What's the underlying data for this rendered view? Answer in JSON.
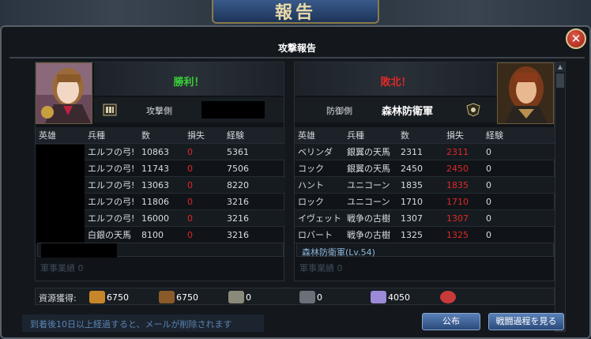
{
  "banner": {
    "title": "報告"
  },
  "window": {
    "title": "攻撃報告",
    "close_label": "✕"
  },
  "attacker": {
    "result": "勝利！",
    "side_label": "攻撃側",
    "headers": [
      "英雄",
      "兵種",
      "数",
      "損失",
      "経験"
    ],
    "rows": [
      {
        "hero": "",
        "type": "エルフの弓!",
        "num": "10863",
        "loss": "0",
        "exp": "5361"
      },
      {
        "hero": "",
        "type": "エルフの弓!",
        "num": "11743",
        "loss": "0",
        "exp": "7506"
      },
      {
        "hero": "",
        "type": "エルフの弓!",
        "num": "13063",
        "loss": "0",
        "exp": "8220"
      },
      {
        "hero": "",
        "type": "エルフの弓!",
        "num": "11806",
        "loss": "0",
        "exp": "3216"
      },
      {
        "hero": "",
        "type": "エルフの弓!",
        "num": "16000",
        "loss": "0",
        "exp": "3216"
      },
      {
        "hero": "",
        "type": "白銀の天馬",
        "num": "8100",
        "loss": "0",
        "exp": "3216"
      }
    ],
    "merit": "軍事業績 0"
  },
  "defender": {
    "result": "敗北！",
    "side_label": "防御側",
    "name": "森林防衛軍",
    "headers": [
      "英雄",
      "兵種",
      "数",
      "損失",
      "経験"
    ],
    "rows": [
      {
        "hero": "ベリンダ",
        "type": "銀翼の天馬",
        "num": "2311",
        "loss": "2311",
        "exp": "0"
      },
      {
        "hero": "コック",
        "type": "銀翼の天馬",
        "num": "2450",
        "loss": "2450",
        "exp": "0"
      },
      {
        "hero": "ハント",
        "type": "ユニコーン",
        "num": "1835",
        "loss": "1835",
        "exp": "0"
      },
      {
        "hero": "ロック",
        "type": "ユニコーン",
        "num": "1710",
        "loss": "1710",
        "exp": "0"
      },
      {
        "hero": "イヴェット",
        "type": "戦争の古樹",
        "num": "1307",
        "loss": "1307",
        "exp": "0"
      },
      {
        "hero": "ロバート",
        "type": "戦争の古樹",
        "num": "1325",
        "loss": "1325",
        "exp": "0"
      }
    ],
    "army_info": "森林防衛軍(Lv.54)",
    "merit": "軍事業績 0"
  },
  "resources": {
    "label": "資源獲得:",
    "items": [
      {
        "icon": "food-icon",
        "value": "6750",
        "color": "#c8862a"
      },
      {
        "icon": "wood-icon",
        "value": "6750",
        "color": "#8a5a2a"
      },
      {
        "icon": "stone-icon",
        "value": "0",
        "color": "#8a8a7a"
      },
      {
        "icon": "iron-icon",
        "value": "0",
        "color": "#6a7078"
      },
      {
        "icon": "crystal-icon",
        "value": "4050",
        "color": "#9a8ad8"
      },
      {
        "icon": "gem-icon",
        "value": "",
        "color": "#c83a3a"
      }
    ]
  },
  "footer": {
    "notice": "到着後10日以上経過すると、メールが削除されます",
    "publish_label": "公布",
    "process_label": "戦闘過程を見る"
  },
  "colors": {
    "win": "#38d038",
    "lose": "#e02828",
    "accent": "#5a80b8"
  }
}
